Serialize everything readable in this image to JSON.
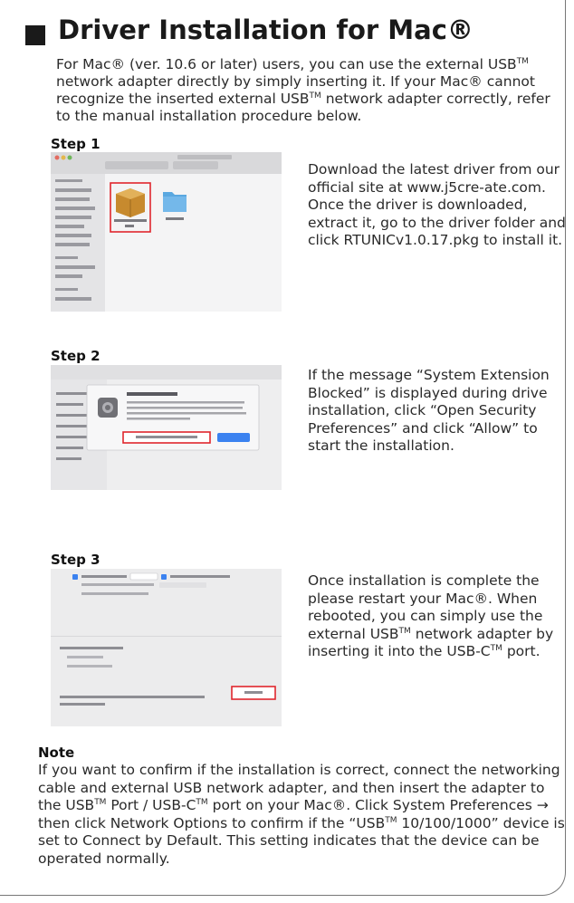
{
  "title": "Driver Installation for Mac®",
  "intro": {
    "part1": "For Mac® (ver. 10.6 or later) users, you can use the external USB",
    "tm1": "TM",
    "part2": " network adapter directly by simply inserting it. If your Mac® cannot recognize the inserted external USB",
    "tm2": "TM",
    "part3": " network adapter correctly, refer to the manual installation procedure below."
  },
  "steps": [
    {
      "label": "Step 1",
      "text": "Download the latest driver from our official site at www.j5cre-ate.com. Once the driver is downloaded, extract it, go to the driver folder and click RTUNICv1.0.17.pkg to install it."
    },
    {
      "label": "Step 2",
      "text": "If the message “System Extension Blocked” is displayed during drive installation, click “Open Security Preferences” and click “Allow” to start the installation."
    },
    {
      "label": "Step 3",
      "part1": "Once installation is complete the please restart your Mac®. When rebooted, you can simply use the external USB",
      "tm1": "TM",
      "part2": " network adapter by inserting it into the USB-C",
      "tm2": "TM",
      "part3": " port."
    }
  ],
  "note": {
    "label": "Note",
    "part1": "If you want to confirm if the installation is correct, connect the networking cable and external USB network adapter, and then insert the adapter to the USB",
    "tm1": "TM",
    "part2": " Port / USB-C",
    "tm2": "TM",
    "part3": " port on your Mac®. Click System Preferences → then click Network Options to confirm if the “USB",
    "tm3": "TM",
    "part4": " 10/100/1000” device is set to Connect by Default. This setting indicates that the device can be operated normally."
  },
  "colors": {
    "highlight_box": "#e0262d",
    "title_square": "#1a1a1a",
    "folder": "#5aa8e0"
  }
}
